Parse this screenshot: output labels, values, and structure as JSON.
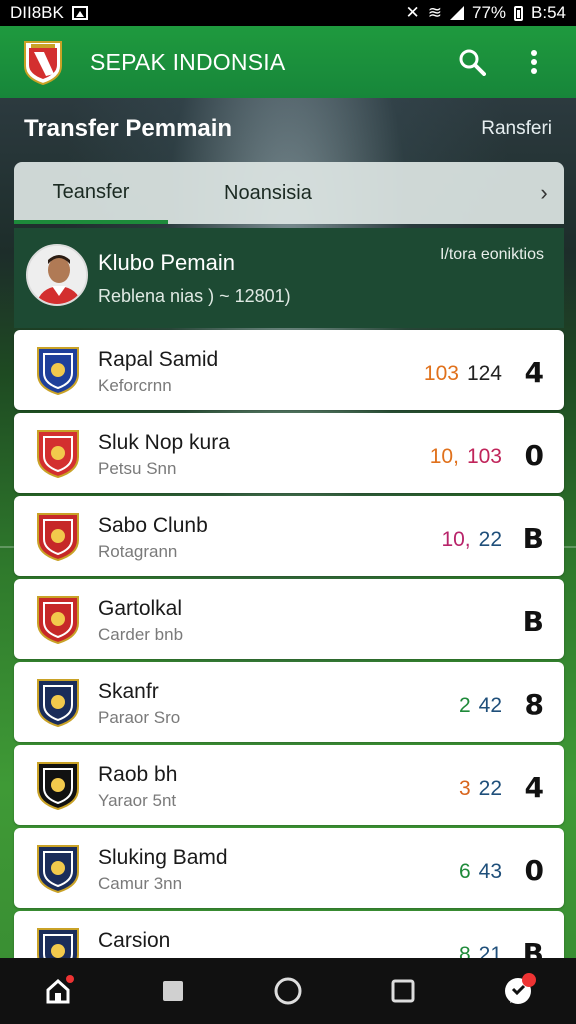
{
  "status_bar": {
    "left_text": "DII8BK",
    "battery_text": "77%",
    "time": "B:54"
  },
  "app": {
    "title": "SEPAK INDONSIA"
  },
  "section": {
    "title": "Transfer Pemmain",
    "right_label": "Ransferi"
  },
  "tabs": [
    {
      "label": "Teansfer",
      "active": true
    },
    {
      "label": "Noansisia",
      "active": false
    }
  ],
  "featured": {
    "name": "Klubo Pemain",
    "subtitle": "Reblena nias ) ~  12801)",
    "more_label": "I/tora eoniktios"
  },
  "clubs": [
    {
      "name": "Rapal Samid",
      "sub": "Keforcrnn",
      "num1": "103",
      "num2": "124",
      "score": "4",
      "c1": "#e0711c",
      "c2": "#222222",
      "crest": "crest-icon",
      "crest_color": "#1f3f9a"
    },
    {
      "name": "Sluk Nop kura",
      "sub": "Petsu Snn",
      "num1": "10,",
      "num2": "103",
      "score": "0",
      "c1": "#e0711c",
      "c2": "#c0245a",
      "crest": "crest-icon",
      "crest_color": "#d32f2f"
    },
    {
      "name": "Sabo Clunb",
      "sub": "Rotagrann",
      "num1": "10,",
      "num2": "22",
      "score": "B",
      "c1": "#b8246a",
      "c2": "#1f4f7a",
      "crest": "crest-icon",
      "crest_color": "#c62828"
    },
    {
      "name": "Gartolkal",
      "sub": "Carder bnb",
      "num1": "",
      "num2": "",
      "score": "B",
      "c1": "#333333",
      "c2": "#333333",
      "crest": "crest-icon",
      "crest_color": "#c62828"
    },
    {
      "name": "Skanfr",
      "sub": "Paraor Sro",
      "num1": "2",
      "num2": "42",
      "score": "8",
      "c1": "#1f8a3a",
      "c2": "#1f4f7a",
      "crest": "crest-icon",
      "crest_color": "#1a2c5a"
    },
    {
      "name": "Raob bh",
      "sub": "Yaraor 5nt",
      "num1": "3",
      "num2": "22",
      "score": "4",
      "c1": "#d8641c",
      "c2": "#1f4f7a",
      "crest": "crest-icon",
      "crest_color": "#111111"
    },
    {
      "name": "Sluking Bamd",
      "sub": "Camur 3nn",
      "num1": "6",
      "num2": "43",
      "score": "0",
      "c1": "#1f8a3a",
      "c2": "#1f4f7a",
      "crest": "crest-icon",
      "crest_color": "#1a2c5a"
    },
    {
      "name": "Carsion",
      "sub": "",
      "num1": "8",
      "num2": "21",
      "score": "B",
      "c1": "#1f8a3a",
      "c2": "#1f4f7a",
      "crest": "crest-icon",
      "crest_color": "#1a2c5a"
    }
  ],
  "colors": {
    "appbar": "#1f9a3e",
    "accent": "#1d8a3a",
    "featured_bg": "#1d4a33"
  }
}
